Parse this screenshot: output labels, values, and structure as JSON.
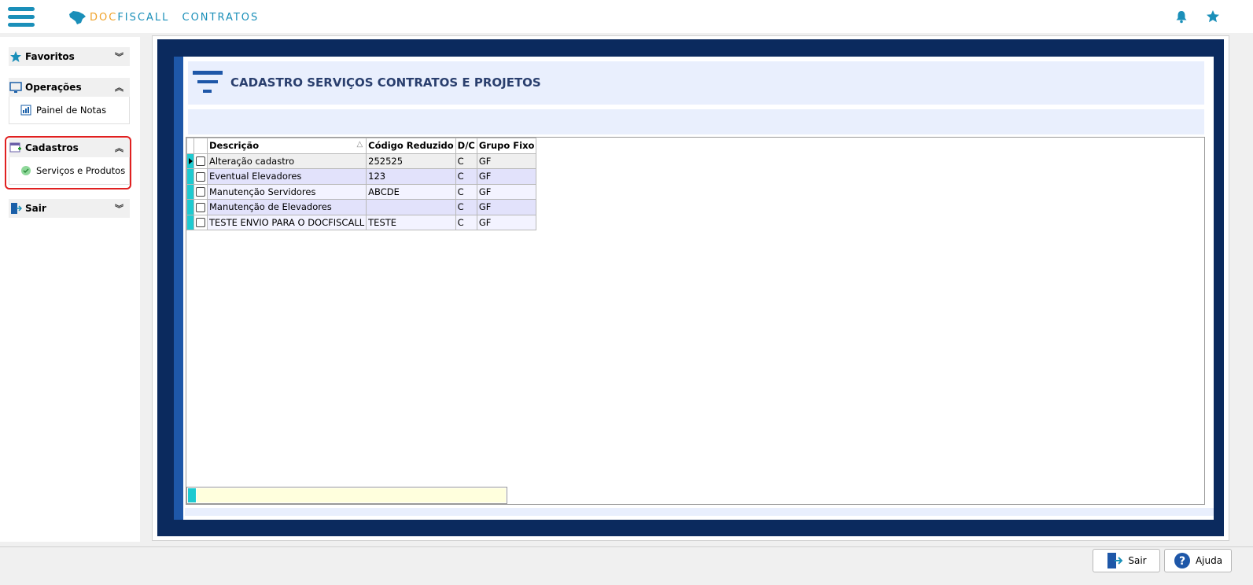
{
  "header": {
    "brand_doc": "DOC",
    "brand_fiscall": "FISCALL",
    "brand_contratos": "CONTRATOS"
  },
  "sidebar": {
    "favoritos": "Favoritos",
    "operacoes": "Operações",
    "painel_notas": "Painel de Notas",
    "cadastros": "Cadastros",
    "servicos_produtos": "Serviços e Produtos",
    "sair": "Sair"
  },
  "main": {
    "title": "CADASTRO SERVIÇOS CONTRATOS E PROJETOS",
    "columns": [
      "Descrição",
      "Código Reduzido",
      "D/C",
      "Grupo Fixo"
    ],
    "rows": [
      {
        "descricao": "Alteração cadastro",
        "codigo": "252525",
        "dc": "C",
        "grupo": "GF"
      },
      {
        "descricao": "Eventual Elevadores",
        "codigo": "123",
        "dc": "C",
        "grupo": "GF"
      },
      {
        "descricao": "Manutenção Servidores",
        "codigo": "ABCDE",
        "dc": "C",
        "grupo": "GF"
      },
      {
        "descricao": "Manutenção de Elevadores",
        "codigo": "",
        "dc": "C",
        "grupo": "GF"
      },
      {
        "descricao": "TESTE ENVIO PARA O DOCFISCALL",
        "codigo": "TESTE",
        "dc": "C",
        "grupo": "GF"
      }
    ]
  },
  "footer": {
    "sair": "Sair",
    "ajuda": "Ajuda"
  }
}
